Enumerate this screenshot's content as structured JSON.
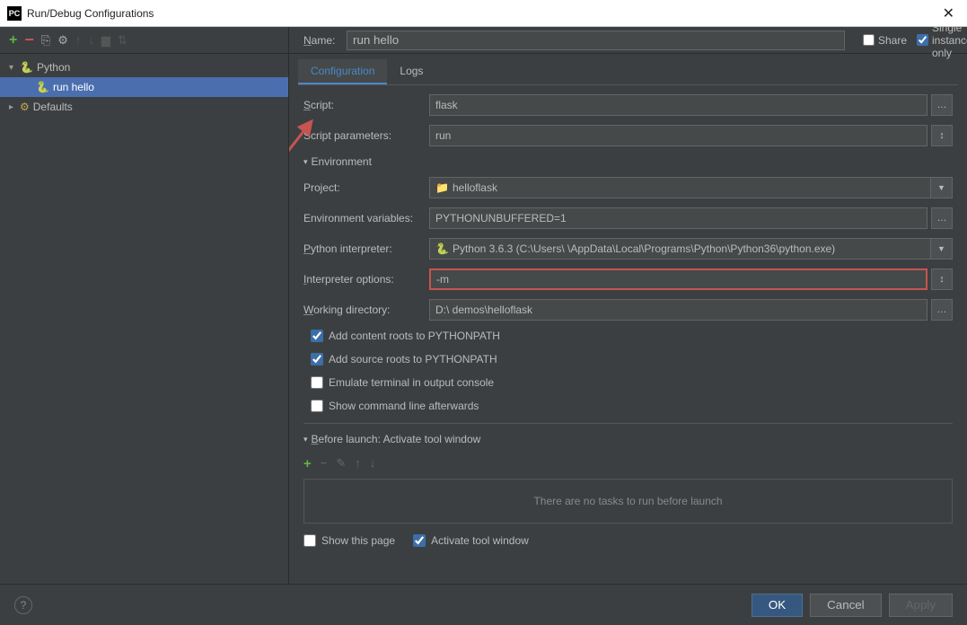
{
  "window": {
    "title": "Run/Debug Configurations"
  },
  "tree": {
    "python": "Python",
    "run_hello": "run hello",
    "defaults": "Defaults"
  },
  "header": {
    "name_label": "Name:",
    "name_value": "run hello",
    "share": "Share",
    "single_instance": "Single instance only"
  },
  "tabs": {
    "config": "Configuration",
    "logs": "Logs"
  },
  "form": {
    "script_label": "Script:",
    "script_value": "flask",
    "params_label": "Script parameters:",
    "params_value": "run",
    "env_header": "Environment",
    "project_label": "Project:",
    "project_value": "helloflask",
    "envvars_label": "Environment variables:",
    "envvars_value": "PYTHONUNBUFFERED=1",
    "interp_label": "Python interpreter:",
    "interp_value": "Python 3.6.3 (C:\\Users\\      \\AppData\\Local\\Programs\\Python\\Python36\\python.exe)",
    "interp_opts_label": "Interpreter options:",
    "interp_opts_value": "-m",
    "workdir_label": "Working directory:",
    "workdir_value": "D:\\                      demos\\helloflask",
    "add_content_roots": "Add content roots to PYTHONPATH",
    "add_source_roots": "Add source roots to PYTHONPATH",
    "emulate_terminal": "Emulate terminal in output console",
    "show_cmd": "Show command line afterwards"
  },
  "before": {
    "header": "Before launch: Activate tool window",
    "empty": "There are no tasks to run before launch",
    "show_page": "Show this page",
    "activate": "Activate tool window"
  },
  "footer": {
    "ok": "OK",
    "cancel": "Cancel",
    "apply": "Apply"
  }
}
